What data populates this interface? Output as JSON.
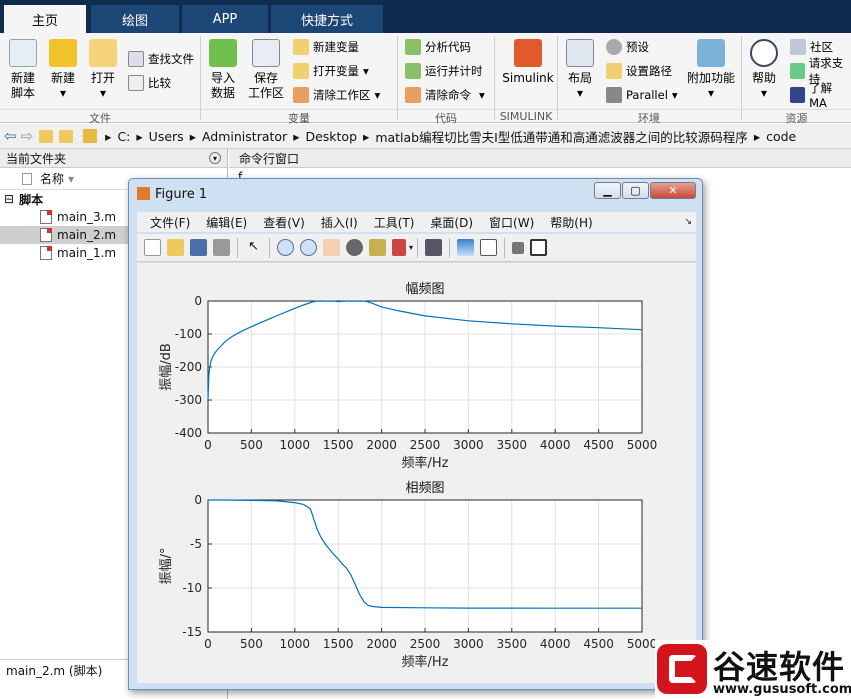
{
  "tabs": [
    "主页",
    "绘图",
    "APP",
    "快捷方式"
  ],
  "ribbon": {
    "new_script": [
      "新建",
      "脚本"
    ],
    "new": "新建",
    "open": "打开",
    "find_files": "查找文件",
    "compare": "比较",
    "import": [
      "导入",
      "数据"
    ],
    "save_ws": [
      "保存",
      "工作区"
    ],
    "new_var": "新建变量",
    "open_var": "打开变量",
    "clear_ws": "清除工作区",
    "analyze": "分析代码",
    "run_time": "运行并计时",
    "clear_cmd": "清除命令",
    "simulink": "Simulink",
    "layout": "布局",
    "prefs": "预设",
    "set_path": "设置路径",
    "parallel": "Parallel",
    "addons": "附加功能",
    "help": "帮助",
    "community": "社区",
    "support": "请求支持",
    "learn": "了解 MA",
    "sections": [
      "文件",
      "变量",
      "代码",
      "SIMULINK",
      "环境",
      "资源"
    ]
  },
  "address": [
    "C:",
    "Users",
    "Administrator",
    "Desktop",
    "matlab编程切比雪夫I型低通带通和高通滤波器之间的比较源码程序",
    "code"
  ],
  "files": {
    "panel_title": "当前文件夹",
    "col_name": "名称",
    "group": "脚本",
    "items": [
      "main_3.m",
      "main_2.m",
      "main_1.m"
    ],
    "status": "main_2.m  (脚本)"
  },
  "command": {
    "title": "命令行窗口",
    "prompt": "f"
  },
  "figure": {
    "title": "Figure 1",
    "menu": [
      "文件(F)",
      "编辑(E)",
      "查看(V)",
      "插入(I)",
      "工具(T)",
      "桌面(D)",
      "窗口(W)",
      "帮助(H)"
    ]
  },
  "chart_data": [
    {
      "type": "line",
      "title": "幅频图",
      "xlabel": "频率/Hz",
      "ylabel": "振幅/dB",
      "xlim": [
        0,
        5000
      ],
      "ylim": [
        -400,
        0
      ],
      "xticks": [
        0,
        500,
        1000,
        1500,
        2000,
        2500,
        3000,
        3500,
        4000,
        4500,
        5000
      ],
      "yticks": [
        0,
        -100,
        -200,
        -300,
        -400
      ],
      "grid": true,
      "x": [
        0,
        10,
        30,
        60,
        100,
        200,
        300,
        400,
        500,
        600,
        700,
        800,
        900,
        1000,
        1100,
        1200,
        1250,
        1300,
        1350,
        1400,
        1450,
        1500,
        1550,
        1600,
        1650,
        1700,
        1750,
        1800,
        1850,
        1900,
        2000,
        2200,
        2500,
        3000,
        3500,
        4000,
        4500,
        5000
      ],
      "y": [
        -300,
        -220,
        -185,
        -165,
        -150,
        -122,
        -104,
        -90,
        -78,
        -66,
        -55,
        -44,
        -33,
        -22,
        -12,
        -3,
        0,
        -1,
        0,
        -1,
        0,
        -2,
        -1,
        0,
        -1,
        0,
        -1,
        0,
        -3,
        -8,
        -18,
        -30,
        -45,
        -60,
        -69,
        -76,
        -81,
        -87
      ]
    },
    {
      "type": "line",
      "title": "相频图",
      "xlabel": "频率/Hz",
      "ylabel": "振幅/°",
      "xlim": [
        0,
        5000
      ],
      "ylim": [
        -15,
        0
      ],
      "xticks": [
        0,
        500,
        1000,
        1500,
        2000,
        2500,
        3000,
        3500,
        4000,
        4500,
        5000
      ],
      "yticks": [
        0,
        -5,
        -10,
        -15
      ],
      "grid": true,
      "x": [
        0,
        200,
        500,
        800,
        1000,
        1100,
        1180,
        1220,
        1260,
        1300,
        1350,
        1400,
        1450,
        1500,
        1550,
        1600,
        1650,
        1700,
        1750,
        1800,
        1850,
        1900,
        2000,
        2500,
        3000,
        4000,
        5000
      ],
      "y": [
        0,
        0,
        -0.05,
        -0.1,
        -0.3,
        -0.5,
        -1.0,
        -2.2,
        -3.4,
        -4.2,
        -5.0,
        -5.6,
        -6.2,
        -6.7,
        -7.3,
        -7.8,
        -8.6,
        -9.7,
        -10.8,
        -11.6,
        -12.0,
        -12.1,
        -12.2,
        -12.25,
        -12.28,
        -12.3,
        -12.3
      ]
    }
  ],
  "watermark": {
    "brand": "谷速软件",
    "url": "www.gususoft.com"
  }
}
